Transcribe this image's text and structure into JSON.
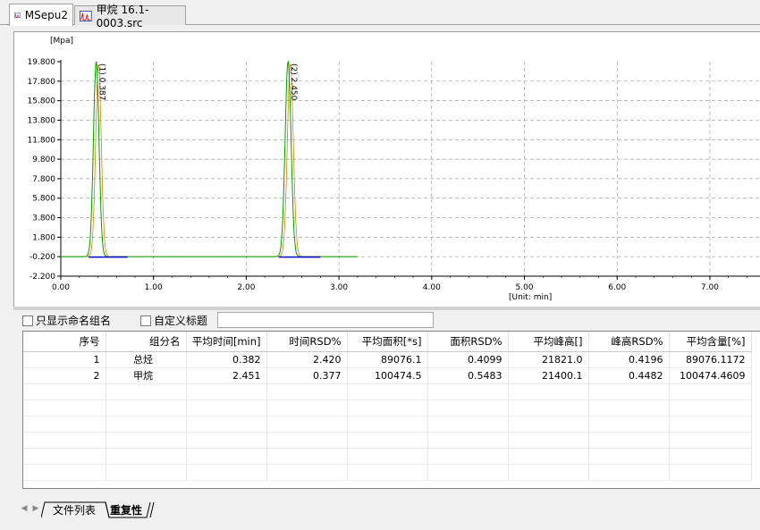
{
  "tabs": [
    {
      "label": "MSepu2",
      "active": true
    },
    {
      "label": "甲烷 16.1-0003.src",
      "active": false
    }
  ],
  "chart_data": {
    "type": "line",
    "y_unit": "[Mpa]",
    "x_unit": "[Unit: min]",
    "ylim": [
      -2.2,
      19.8
    ],
    "xlim": [
      0.0,
      7.5
    ],
    "y_ticks": [
      "19.800",
      "17.800",
      "15.800",
      "13.800",
      "11.800",
      "9.800",
      "7.800",
      "5.800",
      "3.800",
      "1.800",
      "-0.200",
      "-2.200"
    ],
    "x_ticks": [
      "0.00",
      "1.00",
      "2.00",
      "3.00",
      "4.00",
      "5.00",
      "6.00",
      "7.00"
    ],
    "grid": true,
    "baseline": -0.2,
    "trace_end": 3.2,
    "peaks": [
      {
        "label": "(1) 0.387",
        "time": 0.382,
        "height": 19.8,
        "width": 0.03
      },
      {
        "label": "(2) 2.450",
        "time": 2.451,
        "height": 19.8,
        "width": 0.032
      }
    ],
    "colors": {
      "trace": "#00a000",
      "fit": "#e08000",
      "baseline": "#0000cc",
      "grid": "#a0a0a0"
    }
  },
  "options": {
    "only_named": "只显示命名组名",
    "custom_title": "自定义标题",
    "title_value": ""
  },
  "table": {
    "columns": [
      "序号",
      "组分名",
      "平均时间[min]",
      "时间RSD%",
      "平均面积[*s]",
      "面积RSD%",
      "平均峰高[]",
      "峰高RSD%",
      "平均含量[%]"
    ],
    "rows": [
      [
        "1",
        "总烃",
        "0.382",
        "2.420",
        "89076.1",
        "0.4099",
        "21821.0",
        "0.4196",
        "89076.1172"
      ],
      [
        "2",
        "甲烷",
        "2.451",
        "0.377",
        "100474.5",
        "0.5483",
        "21400.1",
        "0.4482",
        "100474.4609"
      ]
    ]
  },
  "bottom_tabs": [
    {
      "label": "文件列表",
      "active": false
    },
    {
      "label": "重复性",
      "active": true
    }
  ]
}
